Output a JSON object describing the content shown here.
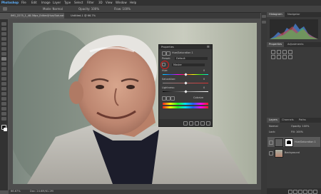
{
  "app": {
    "title": "Photoshop"
  },
  "menu": [
    "File",
    "Edit",
    "Image",
    "Layer",
    "Type",
    "Select",
    "Filter",
    "3D",
    "View",
    "Window",
    "Help"
  ],
  "options_bar": {
    "mode": "Mode: Normal",
    "opacity": "Opacity: 100%",
    "flow": "Flow: 100%"
  },
  "document_tabs": [
    {
      "label": "IMG_2275_1_48.56px_Edited(Hue/Saturation 1, Mask/8) *",
      "active": true
    },
    {
      "label": "Untitled-1 @ 66.7%",
      "active": false
    }
  ],
  "status": {
    "zoom": "66.67%",
    "doc": "Doc: 24.6M/61.2M"
  },
  "panels": {
    "top_tabs": [
      "Histogram",
      "Navigator"
    ],
    "properties_tabs": [
      "Properties",
      "Adjustments"
    ],
    "layers_tabs": [
      "Layers",
      "Channels",
      "Paths"
    ],
    "blend_mode": "Normal",
    "opacity": "Opacity: 100%",
    "fill": "Fill: 100%",
    "lock": "Lock:",
    "layers": [
      {
        "name": "Hue/Saturation 1",
        "selected": true
      },
      {
        "name": "Background",
        "selected": false
      }
    ]
  },
  "hue_saturation": {
    "title": "Properties",
    "preset_label": "Preset:",
    "preset_value": "Default",
    "channel": "Master",
    "hue_label": "Hue:",
    "hue_value": "0",
    "saturation_label": "Saturation:",
    "saturation_value": "0",
    "lightness_label": "Lightness:",
    "lightness_value": "0",
    "colorize_label": "Colorize",
    "hue_slider": 0.5,
    "saturation_slider": 0.5,
    "lightness_slider": 0.5
  },
  "colors": {
    "accent_highlight": "#d0201f",
    "selection": "#5a5a5a"
  },
  "icons": [
    "move-icon",
    "marquee-icon",
    "lasso-icon",
    "brush-icon",
    "eye-icon",
    "fx-icon",
    "trash-icon",
    "new-layer-icon",
    "hand-target-icon"
  ]
}
